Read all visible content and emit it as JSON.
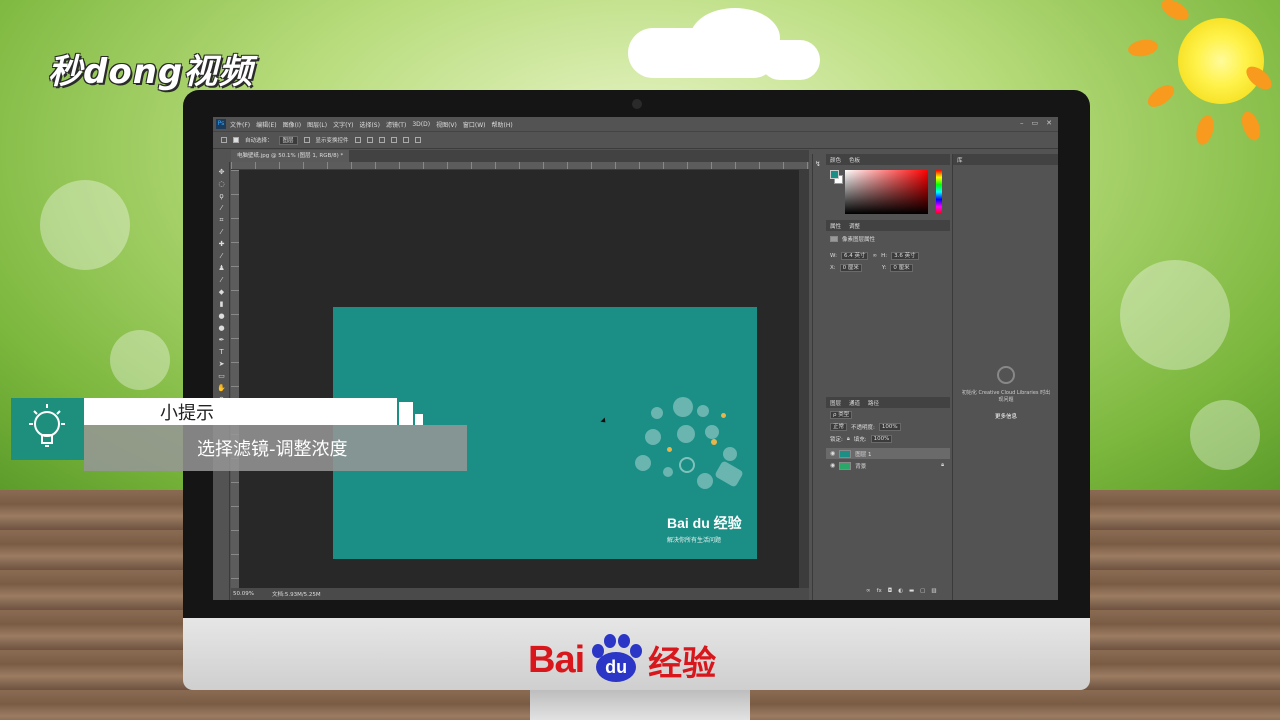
{
  "watermark": {
    "brand": "秒dong视频"
  },
  "tip": {
    "title": "小提示",
    "body": "选择滤镜-调整浓度"
  },
  "monitor_brand": {
    "bai": "Bai",
    "du": "du",
    "jingyan": "经验"
  },
  "photoshop": {
    "app_icon": "Ps",
    "menu": [
      "文件(F)",
      "编辑(E)",
      "图像(I)",
      "图层(L)",
      "文字(Y)",
      "选择(S)",
      "滤镜(T)",
      "3D(D)",
      "视图(V)",
      "窗口(W)",
      "帮助(H)"
    ],
    "window_controls": [
      "–",
      "▭",
      "✕"
    ],
    "options_bar": {
      "auto_select_label": "自动选择：",
      "auto_select_value": "图层",
      "show_transform": "显示变换控件"
    },
    "document_tab": "电脑壁纸.jpg @ 50.1% (图层 1, RGB/8) *",
    "status": {
      "zoom": "50.09%",
      "doc_size": "文档:5.93M/5.25M"
    },
    "document_art": {
      "brand_text": "Bai du 经验",
      "tagline": "解决你所有生活问题"
    },
    "panels": {
      "color_tabs": [
        "颜色",
        "色板"
      ],
      "properties_tabs": [
        "属性",
        "调整"
      ],
      "properties_title": "像素图层属性",
      "w_label": "W:",
      "w_value": "6.4 英寸",
      "h_label": "H:",
      "h_value": "3.6 英寸",
      "x_label": "X:",
      "x_value": "0 厘米",
      "y_label": "Y:",
      "y_value": "0 厘米",
      "layers_tabs": [
        "图层",
        "通道",
        "路径"
      ],
      "layer_filter": "ρ 类型",
      "blend_mode": "正常",
      "opacity_label": "不透明度:",
      "opacity_value": "100%",
      "lock_label": "锁定:",
      "fill_label": "填充:",
      "fill_value": "100%",
      "layers": [
        {
          "name": "图层 1"
        },
        {
          "name": "背景"
        }
      ],
      "libraries_tab": "库",
      "libraries_message": "初始化 Creative Cloud Libraries 时出现问题",
      "libraries_link": "更多信息"
    }
  },
  "colors": {
    "teal": "#1b8e85",
    "baidu_red": "#d8161b",
    "baidu_blue": "#2b35c6",
    "ps_dark": "#535353"
  }
}
